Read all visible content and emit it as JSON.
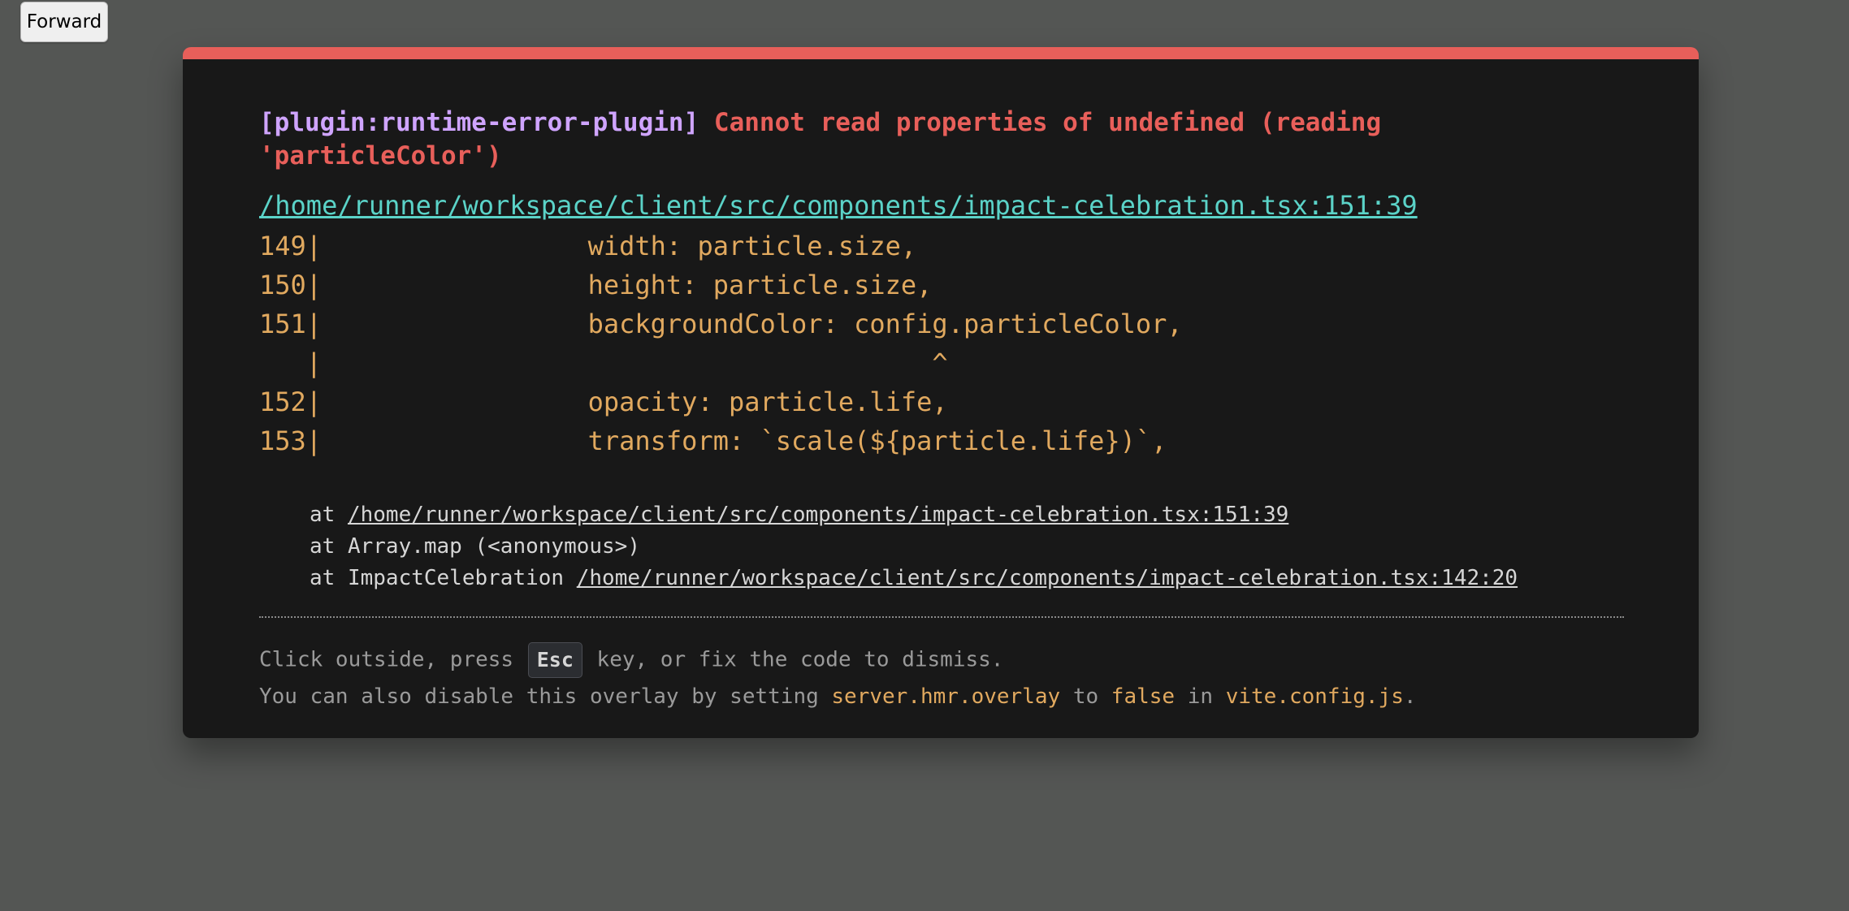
{
  "forward_button": {
    "label": "Forward"
  },
  "error": {
    "plugin": "[plugin:runtime-error-plugin]",
    "message": "Cannot read properties of undefined (reading 'particleColor')",
    "file": "/home/runner/workspace/client/src/components/impact-celebration.tsx:151:39",
    "frame": [
      "149|                 width: particle.size,",
      "150|                 height: particle.size,",
      "151|                 backgroundColor: config.particleColor,",
      "   |                                       ^",
      "152|                 opacity: particle.life,",
      "153|                 transform: `scale(${particle.life})`,"
    ],
    "stack": [
      {
        "prefix": "at ",
        "link": "/home/runner/workspace/client/src/components/impact-celebration.tsx:151:39"
      },
      {
        "prefix": "at Array.map (<anonymous>)",
        "link": ""
      },
      {
        "prefix": "at ImpactCelebration ",
        "link": "/home/runner/workspace/client/src/components/impact-celebration.tsx:142:20"
      }
    ]
  },
  "tips": {
    "line1_before": "Click outside, press ",
    "esc_key": "Esc",
    "line1_after": " key, or fix the code to dismiss.",
    "line2_part1": "You can also disable this overlay by setting ",
    "line2_code1": "server.hmr.overlay",
    "line2_part2": " to ",
    "line2_code2": "false",
    "line2_part3": " in ",
    "line2_code3": "vite.config.js",
    "line2_part4": "."
  },
  "colors": {
    "accent_bar": "#e85f5a",
    "plugin_text": "#cfa4ff",
    "error_text": "#e85f5a",
    "file_link": "#5bd3c8",
    "code_frame": "#e1a95f"
  }
}
